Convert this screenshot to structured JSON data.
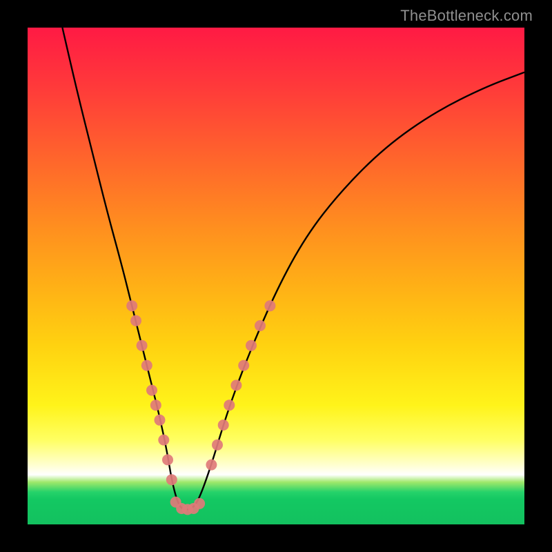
{
  "watermark": "TheBottleneck.com",
  "chart_data": {
    "type": "line",
    "title": "",
    "xlabel": "",
    "ylabel": "",
    "xlim": [
      0,
      100
    ],
    "ylim": [
      0,
      100
    ],
    "grid": false,
    "legend": false,
    "note": "No axis ticks or legend visible; values estimated from pixel positions on a 0–100 scale.",
    "series": [
      {
        "name": "curve",
        "color": "#000000",
        "x": [
          7,
          10,
          13,
          16,
          19,
          21,
          23,
          25,
          26.5,
          28,
          29,
          30,
          31,
          33,
          34.5,
          37,
          40,
          44,
          50,
          56,
          63,
          72,
          82,
          92,
          100
        ],
        "y": [
          100,
          87,
          75,
          63,
          52,
          44,
          36,
          28,
          22,
          15,
          9,
          5,
          3,
          3,
          5,
          12,
          22,
          33,
          47,
          58,
          67,
          76,
          83,
          88,
          91
        ]
      }
    ],
    "markers": [
      {
        "name": "dots-left",
        "color": "#e07a7a",
        "shape": "circle",
        "r": 8,
        "points": [
          {
            "x": 21.0,
            "y": 44
          },
          {
            "x": 21.8,
            "y": 41
          },
          {
            "x": 23.0,
            "y": 36
          },
          {
            "x": 24.0,
            "y": 32
          },
          {
            "x": 25.0,
            "y": 27
          },
          {
            "x": 25.8,
            "y": 24
          },
          {
            "x": 26.6,
            "y": 21
          },
          {
            "x": 27.4,
            "y": 17
          },
          {
            "x": 28.2,
            "y": 13
          },
          {
            "x": 29.0,
            "y": 9
          }
        ]
      },
      {
        "name": "dots-right",
        "color": "#e07a7a",
        "shape": "circle",
        "r": 8,
        "points": [
          {
            "x": 37.0,
            "y": 12
          },
          {
            "x": 38.2,
            "y": 16
          },
          {
            "x": 39.4,
            "y": 20
          },
          {
            "x": 40.6,
            "y": 24
          },
          {
            "x": 42.0,
            "y": 28
          },
          {
            "x": 43.5,
            "y": 32
          },
          {
            "x": 45.0,
            "y": 36
          },
          {
            "x": 46.8,
            "y": 40
          },
          {
            "x": 48.8,
            "y": 44
          }
        ]
      },
      {
        "name": "dots-trough",
        "color": "#e07a7a",
        "shape": "circle",
        "r": 8,
        "points": [
          {
            "x": 29.8,
            "y": 4.5
          },
          {
            "x": 31.0,
            "y": 3.2
          },
          {
            "x": 32.2,
            "y": 3.0
          },
          {
            "x": 33.4,
            "y": 3.2
          },
          {
            "x": 34.6,
            "y": 4.2
          }
        ]
      }
    ]
  }
}
